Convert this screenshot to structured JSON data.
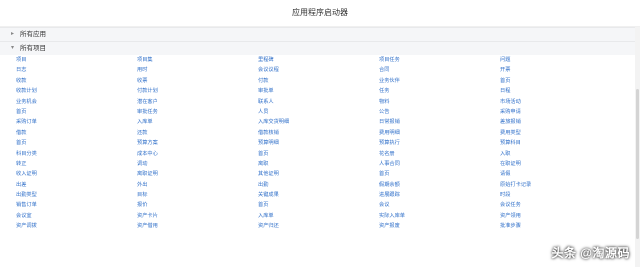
{
  "dialog": {
    "title": "应用程序启动器"
  },
  "sections": [
    {
      "label": "所有应用",
      "expanded": false
    },
    {
      "label": "所有项目",
      "expanded": true
    }
  ],
  "items": [
    "项目",
    "项目集",
    "里程碑",
    "项目任务",
    "问题",
    "日志",
    "用时",
    "会议议程",
    "合同",
    "开票",
    "收款",
    "收票",
    "付款",
    "业务伙伴",
    "首页",
    "收款计划",
    "付款计划",
    "审批单",
    "任务",
    "日程",
    "业务机会",
    "潜在客户",
    "联系人",
    "物料",
    "市场活动",
    "首页",
    "审批任务",
    "人员",
    "公告",
    "采购申请",
    "采购订单",
    "入库单",
    "入库交货明细",
    "日常报销",
    "差旅报销",
    "借款",
    "还款",
    "借款核销",
    "费用明细",
    "费用类型",
    "首页",
    "预算方案",
    "预算明细",
    "预算执行",
    "预算科目",
    "科目分类",
    "成本中心",
    "首页",
    "花名册",
    "入职",
    "转正",
    "调动",
    "离职",
    "人事合同",
    "在职证明",
    "收入证明",
    "离职证明",
    "其他证明",
    "首页",
    "请假",
    "出差",
    "外出",
    "出勤",
    "假期余额",
    "原始打卡记录",
    "出勤类型",
    "目标",
    "关键成果",
    "进展跟踪",
    "时段",
    "销售订单",
    "报价",
    "首页",
    "会议",
    "会议任务",
    "会议室",
    "资产卡片",
    "入库单",
    "实际入库单",
    "资产领用",
    "资产调拨",
    "资产借用",
    "资产归还",
    "资产报废",
    "批准步骤"
  ],
  "watermark": "头条 @淘源码"
}
